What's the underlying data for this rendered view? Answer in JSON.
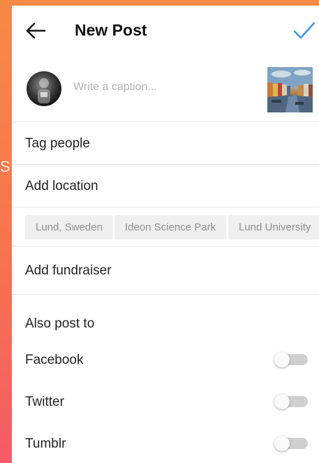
{
  "background_text": "SC",
  "header": {
    "title": "New Post",
    "back_icon": "arrow-left-icon",
    "done_icon": "checkmark-icon",
    "accent_color": "#3897f0"
  },
  "caption": {
    "placeholder": "Write a caption...",
    "value": ""
  },
  "rows": {
    "tag_people": "Tag people",
    "add_location": "Add location",
    "add_fundraiser": "Add fundraiser"
  },
  "location_suggestions": [
    "Lund, Sweden",
    "Ideon Science Park",
    "Lund University"
  ],
  "also_post": {
    "title": "Also post to",
    "services": [
      {
        "label": "Facebook",
        "enabled": false
      },
      {
        "label": "Twitter",
        "enabled": false
      },
      {
        "label": "Tumblr",
        "enabled": false
      }
    ]
  }
}
